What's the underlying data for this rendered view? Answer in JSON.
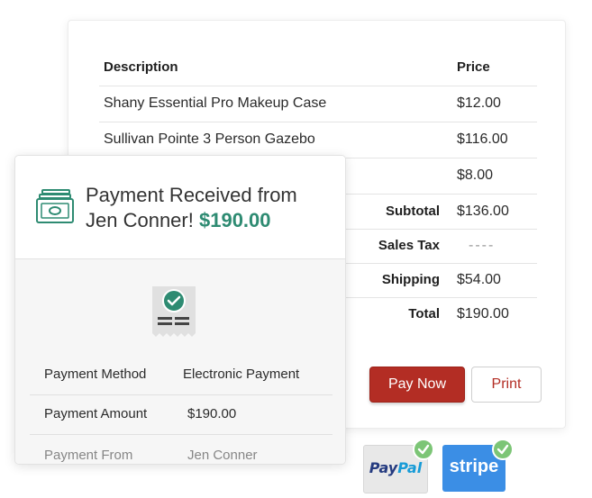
{
  "invoice": {
    "headers": {
      "description": "Description",
      "price": "Price"
    },
    "items": [
      {
        "description": "Shany Essential Pro Makeup Case",
        "price": "$12.00"
      },
      {
        "description": "Sullivan Pointe 3 Person Gazebo",
        "price": "$116.00"
      },
      {
        "description": "",
        "price": "$8.00"
      }
    ],
    "summary": {
      "subtotal_label": "Subtotal",
      "subtotal": "$136.00",
      "tax_label": "Sales Tax",
      "tax": "----",
      "shipping_label": "Shipping",
      "shipping": "$54.00",
      "total_label": "Total",
      "total": "$190.00"
    },
    "buttons": {
      "pay_now": "Pay Now",
      "print": "Print"
    }
  },
  "payment_card": {
    "title_prefix": "Payment Received from",
    "title_name": "Jen Conner!",
    "amount": "$190.00",
    "rows": [
      {
        "label": "Payment Method",
        "value": "Electronic Payment"
      },
      {
        "label": "Payment Amount",
        "value": "$190.00"
      },
      {
        "label": "Payment From",
        "value": "Jen Conner"
      }
    ],
    "accent": "#2e8b72"
  },
  "logos": {
    "paypal_a": "Pay",
    "paypal_b": "Pal",
    "stripe": "stripe"
  },
  "icons": [
    "money-icon",
    "receipt-check-icon",
    "check-badge-icon"
  ],
  "colors": {
    "pay_button": "#b32d24",
    "stripe": "#3b8ee5",
    "check": "#7cc576"
  }
}
